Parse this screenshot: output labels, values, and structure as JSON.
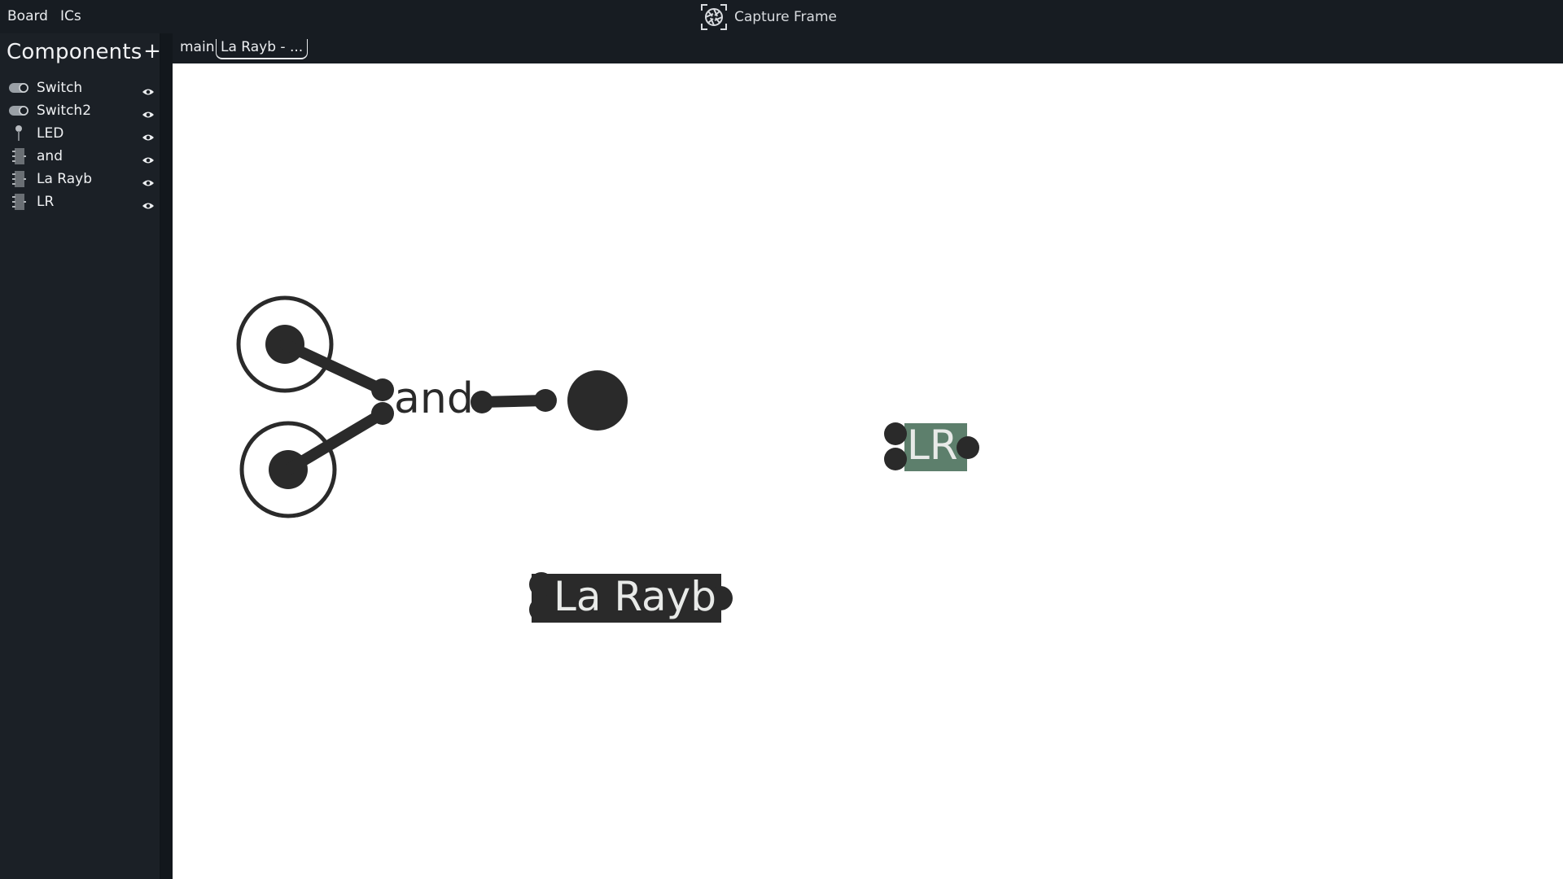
{
  "menu": {
    "board": "Board",
    "ics": "ICs"
  },
  "capture": {
    "label": "Capture Frame",
    "icon": "camera-aperture-icon"
  },
  "sidebar": {
    "title": "Components",
    "add_label": "+",
    "items": [
      {
        "label": "Switch",
        "icon": "switch-icon"
      },
      {
        "label": "Switch2",
        "icon": "switch-icon"
      },
      {
        "label": "LED",
        "icon": "led-icon"
      },
      {
        "label": "and",
        "icon": "chip-icon"
      },
      {
        "label": "La Rayb",
        "icon": "chip-icon"
      },
      {
        "label": "LR",
        "icon": "chip-icon"
      }
    ]
  },
  "tabs": [
    {
      "label": "main",
      "active": false
    },
    {
      "label": "La Rayb - ...",
      "active": true
    }
  ],
  "canvas": {
    "and_label": "and",
    "lr_label": "LR",
    "larayb_label": "La Rayb",
    "colors": {
      "wire": "#2a2a2a",
      "lr_fill": "#5d7f6c",
      "larayb_fill": "#2a2a2a",
      "label_light": "#e8eae8"
    }
  }
}
